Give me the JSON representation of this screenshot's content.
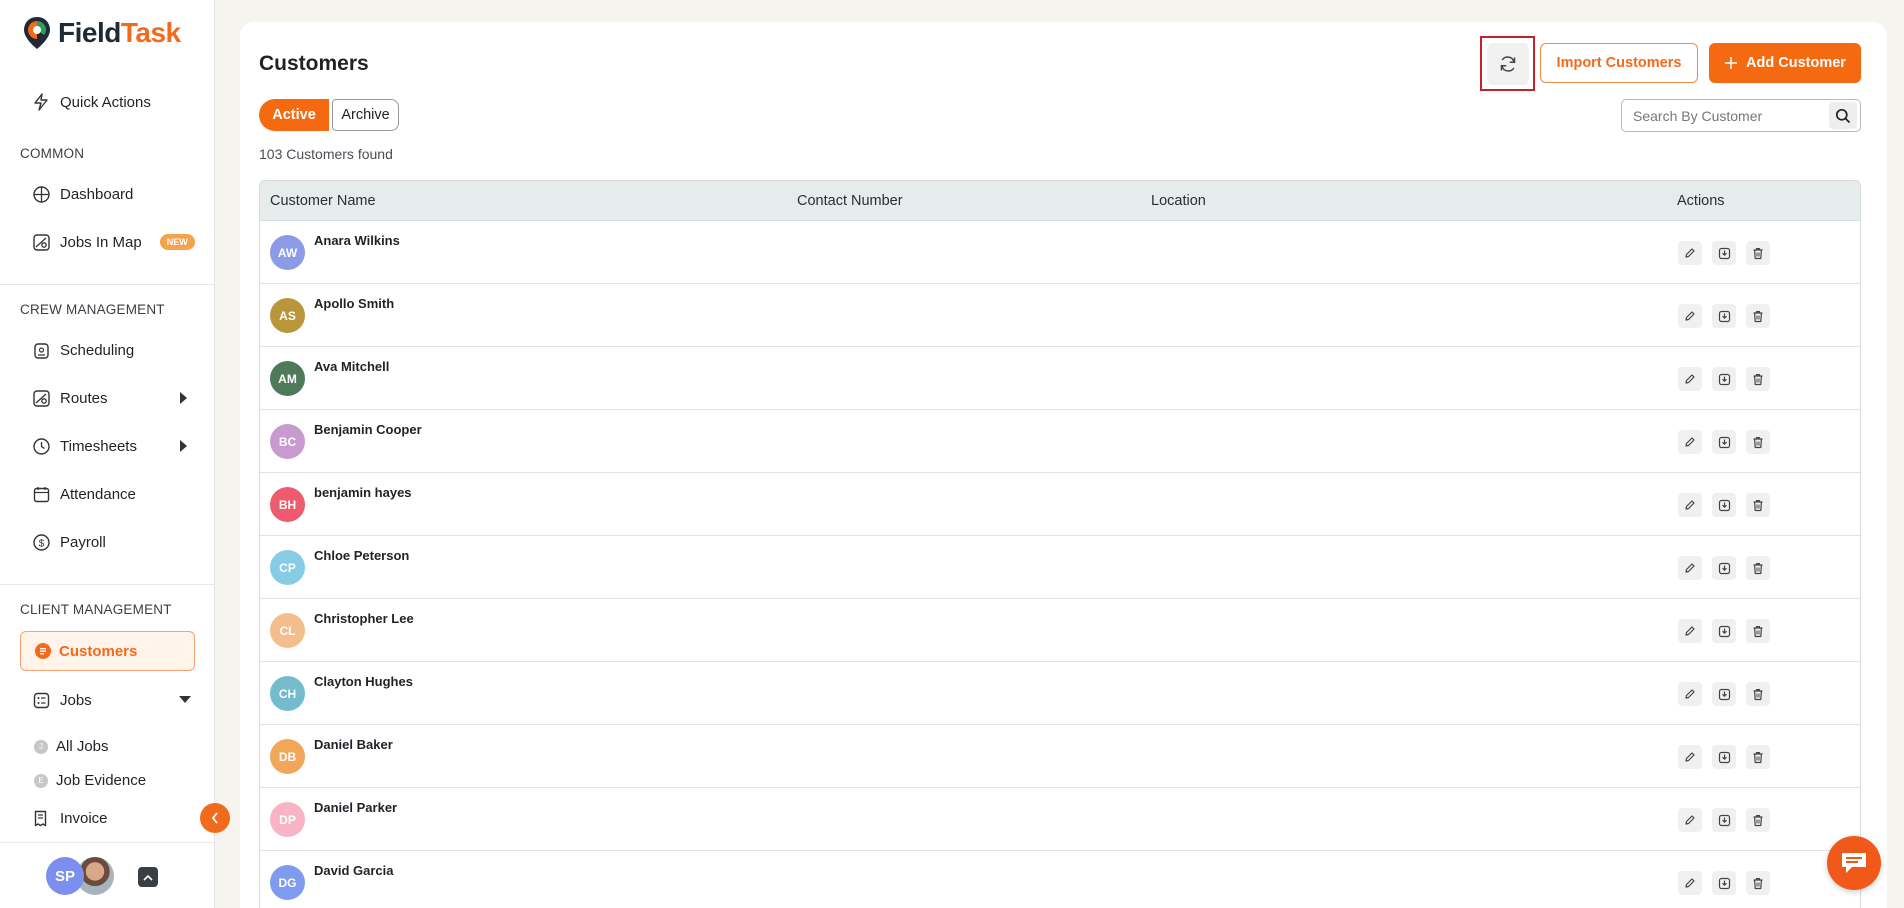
{
  "brand": {
    "name_part1": "Field",
    "name_part2": "Task",
    "accent": "#f26a1b"
  },
  "sidebar": {
    "quick_actions": "Quick Actions",
    "sections": {
      "common": "COMMON",
      "crew": "CREW MANAGEMENT",
      "client": "CLIENT MANAGEMENT"
    },
    "items": {
      "dashboard": "Dashboard",
      "jobs_in_map": "Jobs In Map",
      "jobs_in_map_badge": "NEW",
      "scheduling": "Scheduling",
      "routes": "Routes",
      "timesheets": "Timesheets",
      "attendance": "Attendance",
      "payroll": "Payroll",
      "customers": "Customers",
      "jobs": "Jobs",
      "all_jobs": "All Jobs",
      "job_evidence": "Job Evidence",
      "invoice": "Invoice"
    },
    "user_initials": "SP"
  },
  "header": {
    "title": "Customers",
    "import_label": "Import Customers",
    "add_label": "Add Customer"
  },
  "tabs": {
    "active": "Active",
    "archive": "Archive"
  },
  "count_text": "103 Customers found",
  "search": {
    "placeholder": "Search By Customer"
  },
  "table": {
    "columns": [
      "Customer Name",
      "Contact Number",
      "Location",
      "Actions"
    ],
    "rows": [
      {
        "initials": "AW",
        "name": "Anara Wilkins",
        "color": "#8b9be6"
      },
      {
        "initials": "AS",
        "name": "Apollo Smith",
        "color": "#b8963a"
      },
      {
        "initials": "AM",
        "name": "Ava Mitchell",
        "color": "#4f7a5a"
      },
      {
        "initials": "BC",
        "name": "Benjamin Cooper",
        "color": "#c99ad0"
      },
      {
        "initials": "BH",
        "name": "benjamin hayes",
        "color": "#ef5b6e"
      },
      {
        "initials": "CP",
        "name": "Chloe Peterson",
        "color": "#86cce6"
      },
      {
        "initials": "CL",
        "name": "Christopher Lee",
        "color": "#f4bd8c"
      },
      {
        "initials": "CH",
        "name": "Clayton Hughes",
        "color": "#74bccc"
      },
      {
        "initials": "DB",
        "name": "Daniel Baker",
        "color": "#f2a65a"
      },
      {
        "initials": "DP",
        "name": "Daniel Parker",
        "color": "#f8b3c7"
      },
      {
        "initials": "DG",
        "name": "David Garcia",
        "color": "#7f9bf0"
      }
    ]
  }
}
